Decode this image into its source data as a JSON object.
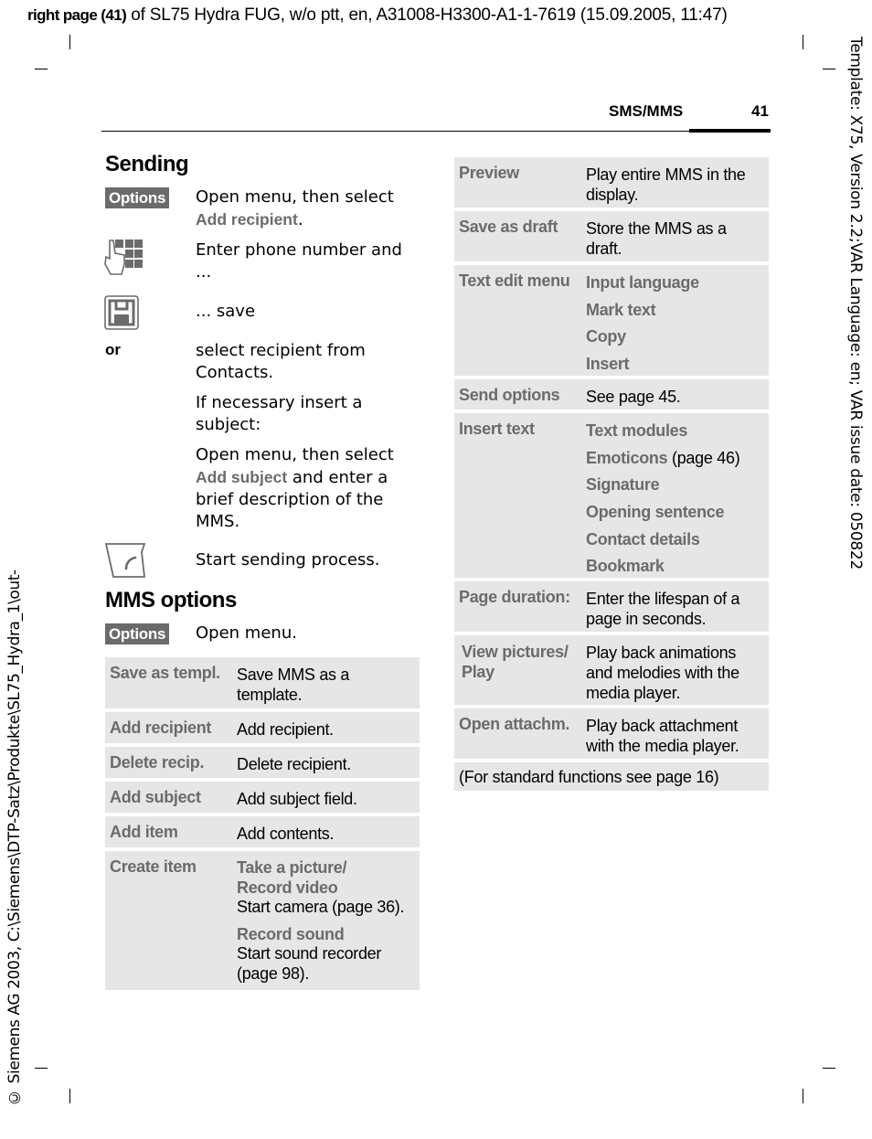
{
  "print_header": {
    "bold": "right page (41)",
    "rest": " of SL75 Hydra FUG, w/o ptt, en, A31008-H3300-A1-1-7619 (15.09.2005, 11:47)"
  },
  "side_right": "Template: X75, Version 2.2;VAR Language: en; VAR issue date: 050822",
  "side_left": "© Siemens AG 2003, C:\\Siemens\\DTP-Satz\\Produkte\\SL75_Hydra_1\\out-",
  "running_header": {
    "section": "SMS/MMS",
    "page": "41"
  },
  "sending": {
    "title": "Sending",
    "steps": [
      {
        "icon": "options-softkey",
        "key_label": "Options",
        "text": "Open menu, then select",
        "menu_ref": "Add recipient",
        "suffix": "."
      },
      {
        "icon": "keypad-icon",
        "text": "Enter phone number and ..."
      },
      {
        "icon": "save-icon",
        "text": "... save"
      },
      {
        "label": "or",
        "text": "select recipient from Contacts."
      },
      {
        "text": "If necessary insert a subject:"
      },
      {
        "text_before": "Open menu, then select",
        "menu_ref": "Add subject",
        "text_after": " and enter a brief description of the MMS."
      },
      {
        "icon": "send-key-icon",
        "text": "Start sending process."
      }
    ]
  },
  "mms_options": {
    "title": "MMS options",
    "key_label": "Options",
    "key_text": "Open menu.",
    "left_table": [
      {
        "key": "Save as templ.",
        "value": "Save MMS as a template."
      },
      {
        "key": "Add recipient",
        "value": "Add recipient."
      },
      {
        "key": "Delete recip.",
        "value": "Delete recipient."
      },
      {
        "key": "Add subject",
        "value": "Add subject field."
      },
      {
        "key": "Add item",
        "value": "Add contents."
      },
      {
        "key": "Create item",
        "sub1": "Take a picture/",
        "sub2": "Record video",
        "sub_text": "Start camera (page 36).",
        "sub3": "Record sound",
        "sub3_text": "Start sound recorder (page 98)."
      }
    ],
    "right_table": [
      {
        "key": "Preview",
        "value": "Play entire MMS in the display."
      },
      {
        "key": "Save as draft",
        "value": "Store the MMS as a draft."
      },
      {
        "key": "Text edit menu",
        "items": [
          "Input language",
          "Mark text",
          "Copy",
          "Insert"
        ]
      },
      {
        "key": "Send options",
        "value": "See page 45."
      },
      {
        "key": "Insert text",
        "items": [
          "Text modules",
          "Emoticons",
          "Signature",
          "Opening sentence",
          "Contact details",
          "Bookmark"
        ],
        "emoticons_note": " (page 46)"
      },
      {
        "key": "Page duration:",
        "value": "Enter the lifespan of a page in seconds."
      },
      {
        "key": "View pictures/",
        "key2": "Play",
        "value": "Play back animations and melodies with the media player."
      },
      {
        "key": "Open attachm.",
        "value": "Play back attachment with the media player."
      }
    ],
    "footnote": "(For standard functions see page 16)"
  }
}
